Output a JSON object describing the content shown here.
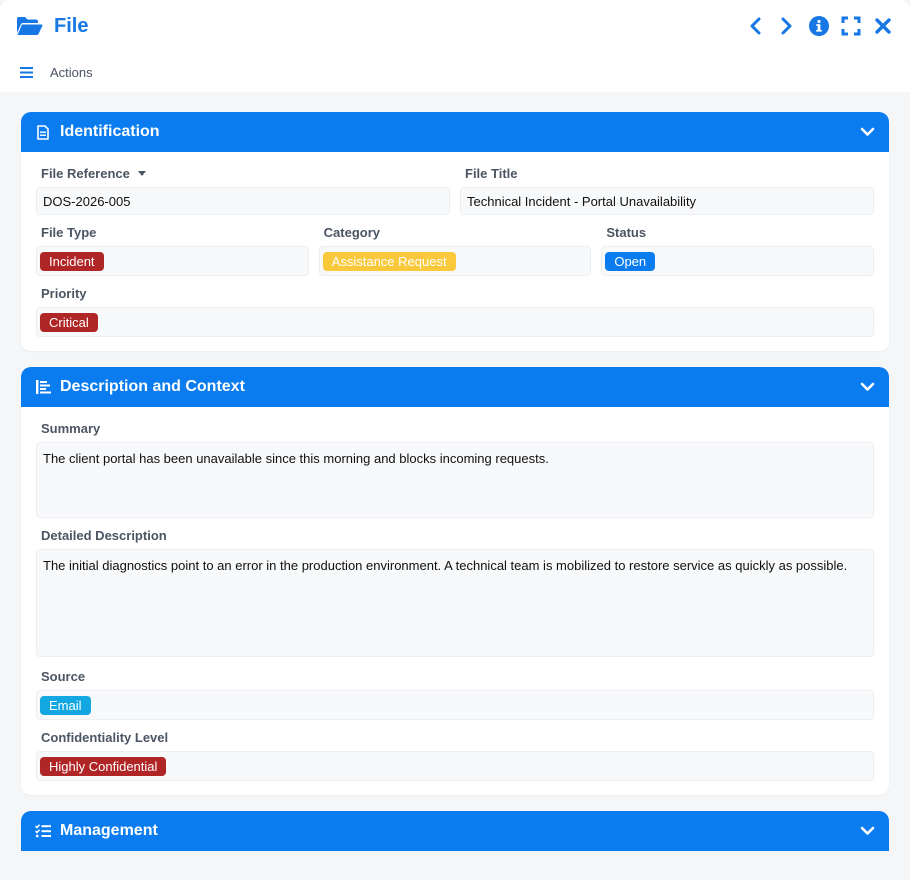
{
  "window": {
    "title": "File",
    "icons": [
      "folder-open-icon",
      "chevron-left-icon",
      "chevron-right-icon",
      "info-icon",
      "fullscreen-icon",
      "close-icon"
    ]
  },
  "menubar": {
    "actions_label": "Actions"
  },
  "identification": {
    "title": "Identification",
    "file_reference_label": "File Reference",
    "file_reference_value": "DOS-2026-005",
    "file_title_label": "File Title",
    "file_title_value": "Technical Incident - Portal Unavailability",
    "file_type_label": "File Type",
    "file_type_value": "Incident",
    "file_type_color": "#b02525",
    "category_label": "Category",
    "category_value": "Assistance Request",
    "category_color": "#f9c93b",
    "status_label": "Status",
    "status_value": "Open",
    "status_color": "#0a7cf0",
    "priority_label": "Priority",
    "priority_value": "Critical",
    "priority_color": "#b02525"
  },
  "description": {
    "title": "Description and Context",
    "summary_label": "Summary",
    "summary_value": "The client portal has been unavailable since this morning and blocks incoming requests.",
    "detailed_label": "Detailed Description",
    "detailed_value": "The initial diagnostics point to an error in the production environment. A technical team is mobilized to restore service as quickly as possible.",
    "source_label": "Source",
    "source_value": "Email",
    "source_color": "#12a7e0",
    "confidentiality_label": "Confidentiality Level",
    "confidentiality_value": "Highly Confidential",
    "confidentiality_color": "#b02525"
  },
  "management": {
    "title": "Management"
  },
  "colors": {
    "accent": "#0a7cf0",
    "title_blue": "#1677e5"
  }
}
